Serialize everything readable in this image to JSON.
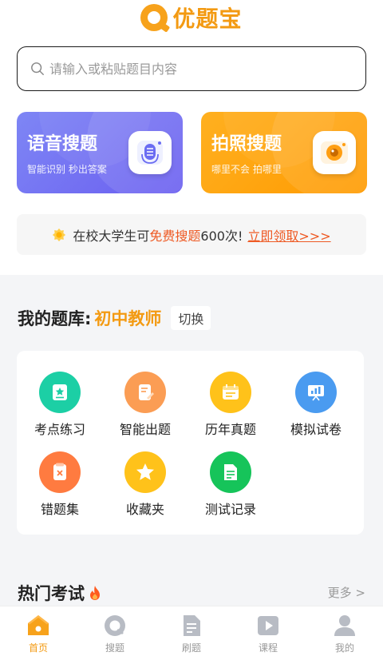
{
  "header": {
    "app_name": "优题宝"
  },
  "search": {
    "placeholder": "请输入或粘贴题目内容"
  },
  "features": [
    {
      "title": "语音搜题",
      "subtitle": "智能识别 秒出答案",
      "icon": "microphone-icon"
    },
    {
      "title": "拍照搜题",
      "subtitle": "哪里不会 拍哪里",
      "icon": "camera-icon"
    }
  ],
  "promo": {
    "prefix": "在校大学生可",
    "highlight": "免费搜题",
    "suffix": "600次!",
    "link": "立即领取>>>"
  },
  "library": {
    "label": "我的题库:",
    "value": "初中教师",
    "switch": "切换"
  },
  "tools": [
    {
      "label": "考点练习",
      "icon": "practice-icon",
      "color": "#1ccfa5"
    },
    {
      "label": "智能出题",
      "icon": "smart-question-icon",
      "color": "#fb9d54"
    },
    {
      "label": "历年真题",
      "icon": "calendar-icon",
      "color": "#ffc21a"
    },
    {
      "label": "模拟试卷",
      "icon": "mock-paper-icon",
      "color": "#4a9bf0"
    },
    {
      "label": "错题集",
      "icon": "wrong-questions-icon",
      "color": "#ff7b40"
    },
    {
      "label": "收藏夹",
      "icon": "star-icon",
      "color": "#ffc21a"
    },
    {
      "label": "测试记录",
      "icon": "test-record-icon",
      "color": "#16c45a"
    }
  ],
  "hot": {
    "title": "热门考试",
    "more": "更多 >"
  },
  "tabbar": [
    {
      "label": "首页",
      "icon": "home-icon",
      "active": true
    },
    {
      "label": "搜题",
      "icon": "search-question-icon",
      "active": false
    },
    {
      "label": "刷题",
      "icon": "document-icon",
      "active": false
    },
    {
      "label": "课程",
      "icon": "video-icon",
      "active": false
    },
    {
      "label": "我的",
      "icon": "user-icon",
      "active": false
    }
  ],
  "colors": {
    "accent": "#f39a12",
    "highlight": "#ee5a24",
    "voice_card": "#7a7ff5",
    "photo_card": "#ffa812"
  }
}
